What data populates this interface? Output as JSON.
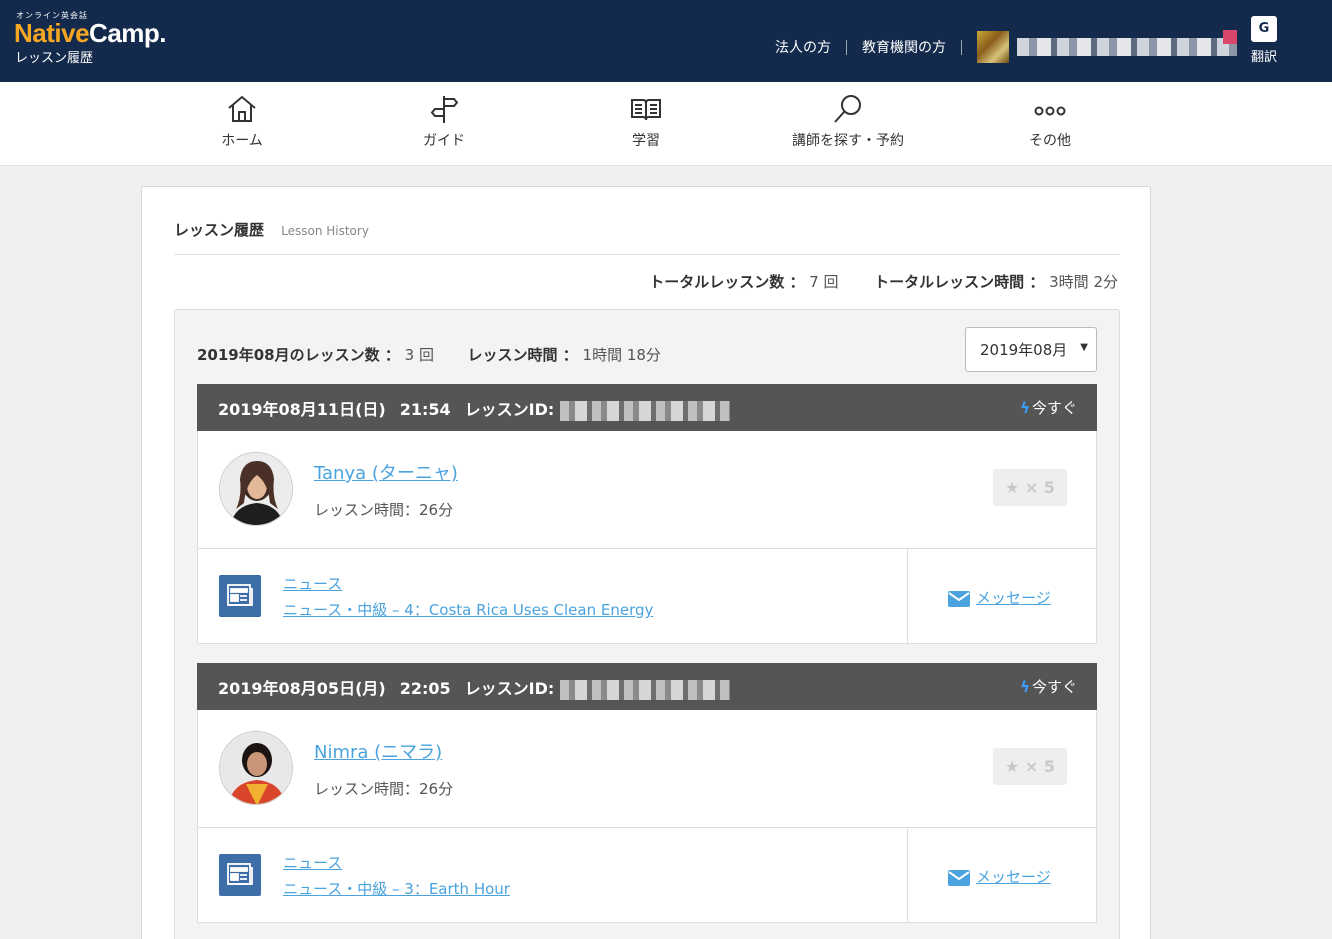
{
  "header": {
    "logo_small": "オンライン英会話",
    "logo_native": "Native",
    "logo_camp": "Camp.",
    "page_subtitle": "レッスン履歴",
    "link_corporate": "法人の方",
    "link_education": "教育機関の方",
    "translate_label": "翻訳",
    "translate_icon_text": "G"
  },
  "nav": {
    "home": "ホーム",
    "guide": "ガイド",
    "study": "学習",
    "search": "講師を探す・予約",
    "other": "その他"
  },
  "card": {
    "title_jp": "レッスン履歴",
    "title_en": "Lesson History",
    "total_lessons_label": "トータルレッスン数 ：",
    "total_lessons_value": "7 回",
    "total_time_label": "トータルレッスン時間 ：",
    "total_time_value": "3時間 2分"
  },
  "month": {
    "count_label": "2019年08月のレッスン数 ：",
    "count_value": "3 回",
    "time_label": "レッスン時間 ：",
    "time_value": "1時間 18分",
    "selected": "2019年08月",
    "arrow": "▼"
  },
  "lessons": [
    {
      "date": "2019年08月11日(日)",
      "time": "21:54",
      "id_label": "レッスンID:",
      "instant_label": "今すぐ",
      "teacher": "Tanya (ターニャ)",
      "duration": "レッスン時間：26分",
      "rating": "★ × 5",
      "category": "ニュース",
      "material": "ニュース・中級 – 4：Costa Rica Uses Clean Energy",
      "message": "メッセージ"
    },
    {
      "date": "2019年08月05日(月)",
      "time": "22:05",
      "id_label": "レッスンID:",
      "instant_label": "今すぐ",
      "teacher": "Nimra (ニマラ)",
      "duration": "レッスン時間：26分",
      "rating": "★ × 5",
      "category": "ニュース",
      "material": "ニュース・中級 – 3：Earth Hour",
      "message": "メッセージ"
    }
  ]
}
